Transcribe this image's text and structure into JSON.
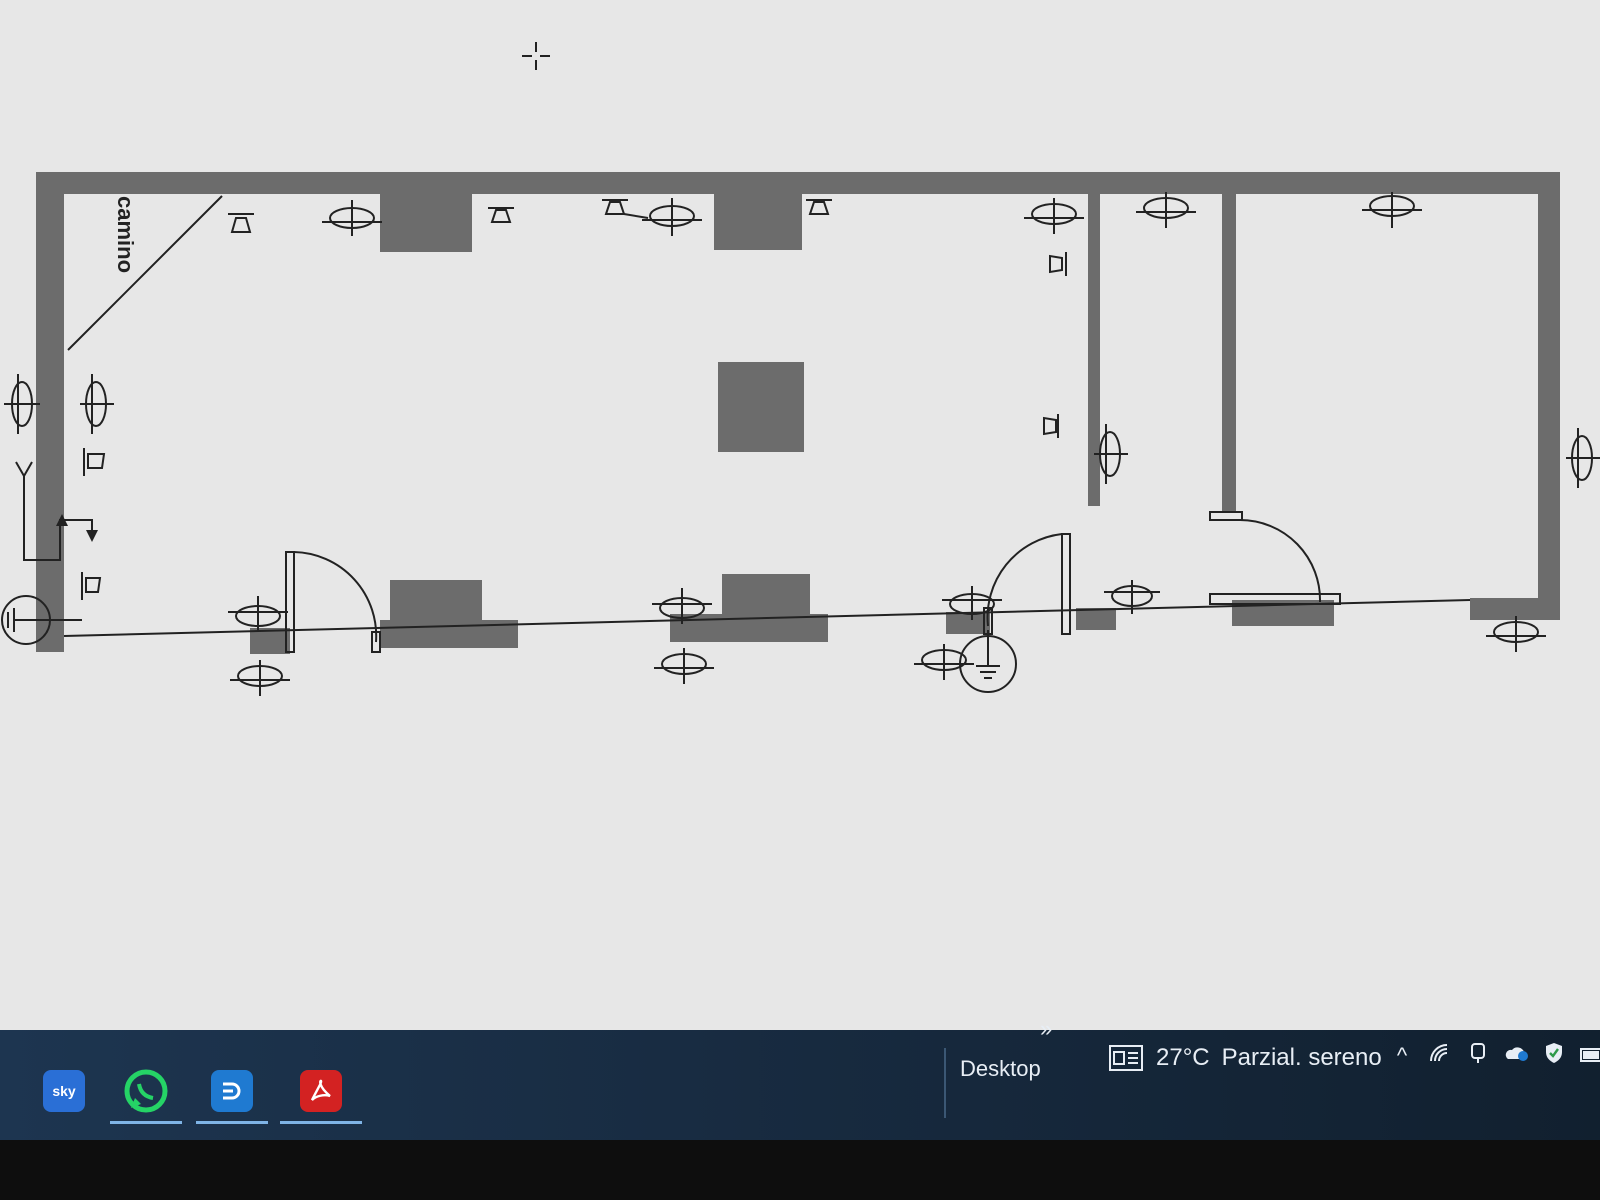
{
  "plan": {
    "room_label": "camino"
  },
  "taskbar": {
    "apps": [
      {
        "name": "Sky",
        "label": "sky"
      },
      {
        "name": "WhatsApp",
        "label": ""
      },
      {
        "name": "Dashlane",
        "label": ""
      },
      {
        "name": "Adobe Acrobat",
        "label": ""
      }
    ],
    "toolbar_label": "Desktop",
    "toolbar_chevron": "»",
    "weather": {
      "temperature": "27°C",
      "condition": "Parzial. sereno"
    },
    "tray": {
      "chevron": "^",
      "icons": [
        "network-icon",
        "meet-icon",
        "onedrive-icon",
        "defender-icon",
        "battery-icon"
      ]
    }
  },
  "colors": {
    "wall": "#6c6c6c",
    "taskbar": "#1d3550",
    "canvas": "#e7e7e7",
    "acrobat": "#d32222",
    "whatsapp": "#25d366",
    "dashlane": "#1f7ad1"
  }
}
